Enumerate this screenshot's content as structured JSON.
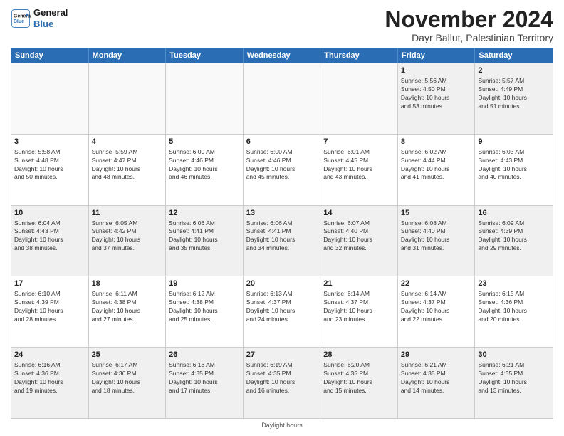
{
  "logo": {
    "line1": "General",
    "line2": "Blue"
  },
  "title": "November 2024",
  "subtitle": "Dayr Ballut, Palestinian Territory",
  "days_of_week": [
    "Sunday",
    "Monday",
    "Tuesday",
    "Wednesday",
    "Thursday",
    "Friday",
    "Saturday"
  ],
  "footer": "Daylight hours",
  "rows": [
    [
      {
        "day": "",
        "info": ""
      },
      {
        "day": "",
        "info": ""
      },
      {
        "day": "",
        "info": ""
      },
      {
        "day": "",
        "info": ""
      },
      {
        "day": "",
        "info": ""
      },
      {
        "day": "1",
        "info": "Sunrise: 5:56 AM\nSunset: 4:50 PM\nDaylight: 10 hours\nand 53 minutes."
      },
      {
        "day": "2",
        "info": "Sunrise: 5:57 AM\nSunset: 4:49 PM\nDaylight: 10 hours\nand 51 minutes."
      }
    ],
    [
      {
        "day": "3",
        "info": "Sunrise: 5:58 AM\nSunset: 4:48 PM\nDaylight: 10 hours\nand 50 minutes."
      },
      {
        "day": "4",
        "info": "Sunrise: 5:59 AM\nSunset: 4:47 PM\nDaylight: 10 hours\nand 48 minutes."
      },
      {
        "day": "5",
        "info": "Sunrise: 6:00 AM\nSunset: 4:46 PM\nDaylight: 10 hours\nand 46 minutes."
      },
      {
        "day": "6",
        "info": "Sunrise: 6:00 AM\nSunset: 4:46 PM\nDaylight: 10 hours\nand 45 minutes."
      },
      {
        "day": "7",
        "info": "Sunrise: 6:01 AM\nSunset: 4:45 PM\nDaylight: 10 hours\nand 43 minutes."
      },
      {
        "day": "8",
        "info": "Sunrise: 6:02 AM\nSunset: 4:44 PM\nDaylight: 10 hours\nand 41 minutes."
      },
      {
        "day": "9",
        "info": "Sunrise: 6:03 AM\nSunset: 4:43 PM\nDaylight: 10 hours\nand 40 minutes."
      }
    ],
    [
      {
        "day": "10",
        "info": "Sunrise: 6:04 AM\nSunset: 4:43 PM\nDaylight: 10 hours\nand 38 minutes."
      },
      {
        "day": "11",
        "info": "Sunrise: 6:05 AM\nSunset: 4:42 PM\nDaylight: 10 hours\nand 37 minutes."
      },
      {
        "day": "12",
        "info": "Sunrise: 6:06 AM\nSunset: 4:41 PM\nDaylight: 10 hours\nand 35 minutes."
      },
      {
        "day": "13",
        "info": "Sunrise: 6:06 AM\nSunset: 4:41 PM\nDaylight: 10 hours\nand 34 minutes."
      },
      {
        "day": "14",
        "info": "Sunrise: 6:07 AM\nSunset: 4:40 PM\nDaylight: 10 hours\nand 32 minutes."
      },
      {
        "day": "15",
        "info": "Sunrise: 6:08 AM\nSunset: 4:40 PM\nDaylight: 10 hours\nand 31 minutes."
      },
      {
        "day": "16",
        "info": "Sunrise: 6:09 AM\nSunset: 4:39 PM\nDaylight: 10 hours\nand 29 minutes."
      }
    ],
    [
      {
        "day": "17",
        "info": "Sunrise: 6:10 AM\nSunset: 4:39 PM\nDaylight: 10 hours\nand 28 minutes."
      },
      {
        "day": "18",
        "info": "Sunrise: 6:11 AM\nSunset: 4:38 PM\nDaylight: 10 hours\nand 27 minutes."
      },
      {
        "day": "19",
        "info": "Sunrise: 6:12 AM\nSunset: 4:38 PM\nDaylight: 10 hours\nand 25 minutes."
      },
      {
        "day": "20",
        "info": "Sunrise: 6:13 AM\nSunset: 4:37 PM\nDaylight: 10 hours\nand 24 minutes."
      },
      {
        "day": "21",
        "info": "Sunrise: 6:14 AM\nSunset: 4:37 PM\nDaylight: 10 hours\nand 23 minutes."
      },
      {
        "day": "22",
        "info": "Sunrise: 6:14 AM\nSunset: 4:37 PM\nDaylight: 10 hours\nand 22 minutes."
      },
      {
        "day": "23",
        "info": "Sunrise: 6:15 AM\nSunset: 4:36 PM\nDaylight: 10 hours\nand 20 minutes."
      }
    ],
    [
      {
        "day": "24",
        "info": "Sunrise: 6:16 AM\nSunset: 4:36 PM\nDaylight: 10 hours\nand 19 minutes."
      },
      {
        "day": "25",
        "info": "Sunrise: 6:17 AM\nSunset: 4:36 PM\nDaylight: 10 hours\nand 18 minutes."
      },
      {
        "day": "26",
        "info": "Sunrise: 6:18 AM\nSunset: 4:35 PM\nDaylight: 10 hours\nand 17 minutes."
      },
      {
        "day": "27",
        "info": "Sunrise: 6:19 AM\nSunset: 4:35 PM\nDaylight: 10 hours\nand 16 minutes."
      },
      {
        "day": "28",
        "info": "Sunrise: 6:20 AM\nSunset: 4:35 PM\nDaylight: 10 hours\nand 15 minutes."
      },
      {
        "day": "29",
        "info": "Sunrise: 6:21 AM\nSunset: 4:35 PM\nDaylight: 10 hours\nand 14 minutes."
      },
      {
        "day": "30",
        "info": "Sunrise: 6:21 AM\nSunset: 4:35 PM\nDaylight: 10 hours\nand 13 minutes."
      }
    ]
  ]
}
